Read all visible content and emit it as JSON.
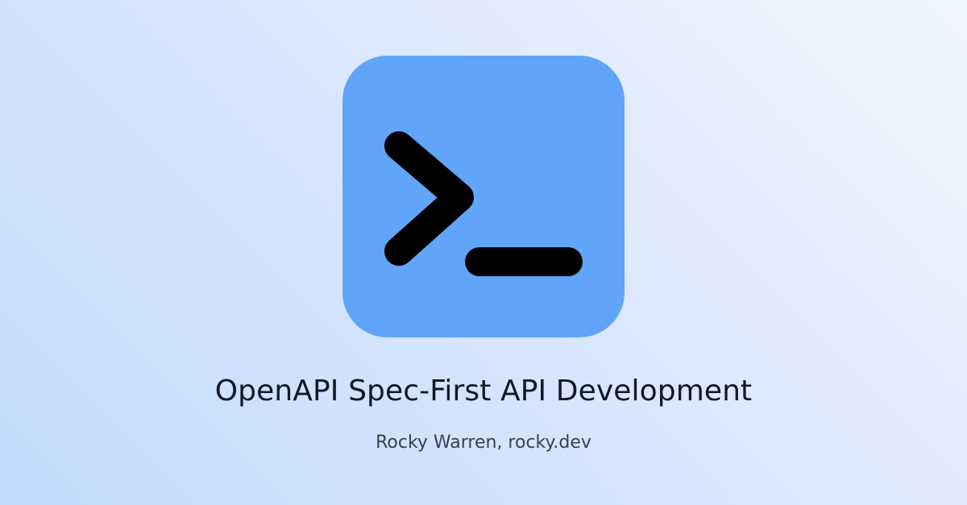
{
  "logo": {
    "icon": "terminal-prompt-icon",
    "tile_color": "#60a5fa",
    "glyph_color": "#000000"
  },
  "title": "OpenAPI Spec-First API Development",
  "byline": "Rocky Warren, rocky.dev",
  "colors": {
    "title_text": "#111827",
    "byline_text": "#374151",
    "background_light": "#f1f6fe",
    "background_dark": "#c3dafd"
  }
}
